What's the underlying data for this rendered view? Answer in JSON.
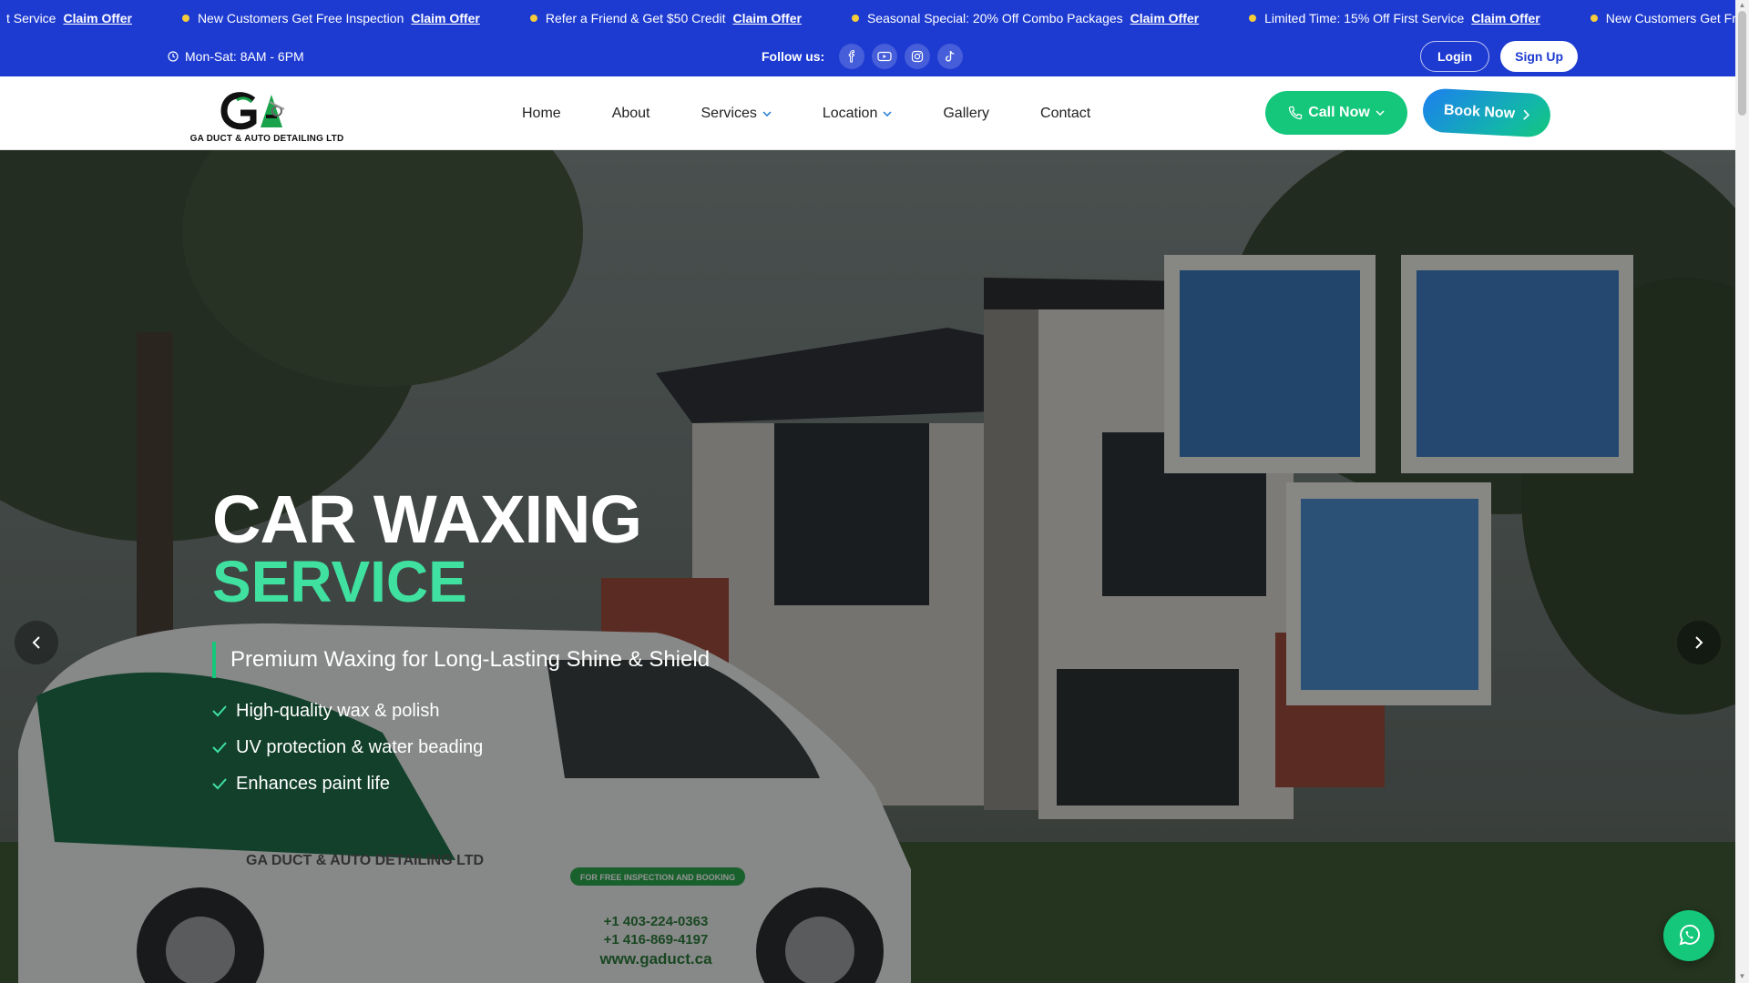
{
  "ticker": {
    "claim_label": "Claim Offer",
    "first_fragment": "t Service",
    "items": [
      "New Customers Get Free Inspection",
      "Refer a Friend & Get $50 Credit",
      "Seasonal Special: 20% Off Combo Packages",
      "Limited Time: 15% Off First Service",
      "New Customers Get Free Ins"
    ],
    "dot_color": "#f5cc3a"
  },
  "topbar": {
    "hours": "Mon-Sat: 8AM - 6PM",
    "follow_label": "Follow us:",
    "socials": [
      "facebook-icon",
      "youtube-icon",
      "instagram-icon",
      "tiktok-icon"
    ],
    "login_label": "Login",
    "signup_label": "Sign Up",
    "bg_color": "#1e3bd1"
  },
  "nav": {
    "logo_caption": "GA DUCT & AUTO DETAILING LTD",
    "items": [
      {
        "label": "Home"
      },
      {
        "label": "About"
      },
      {
        "label": "Services"
      },
      {
        "label": "Location"
      },
      {
        "label": "Gallery"
      },
      {
        "label": "Contact"
      }
    ],
    "call_label": "Call Now",
    "book_label": "Book Now",
    "accent_green": "#14c77a"
  },
  "hero": {
    "title_line1": "CAR WAXING",
    "title_line2": "SERVICE",
    "subtitle": "Premium Waxing for Long-Lasting Shine & Shield",
    "features": [
      "High-quality wax & polish",
      "UV protection & water beading",
      "Enhances paint life"
    ],
    "van_text": {
      "company": "GA DUCT & AUTO DETAILING LTD",
      "badge": "FOR FREE INSPECTION AND BOOKING",
      "phone1": "+1 403-224-0363",
      "phone2": "+1 416-869-4197",
      "website": "www.gaduct.ca"
    },
    "highlight_color": "#3fe0a0"
  }
}
